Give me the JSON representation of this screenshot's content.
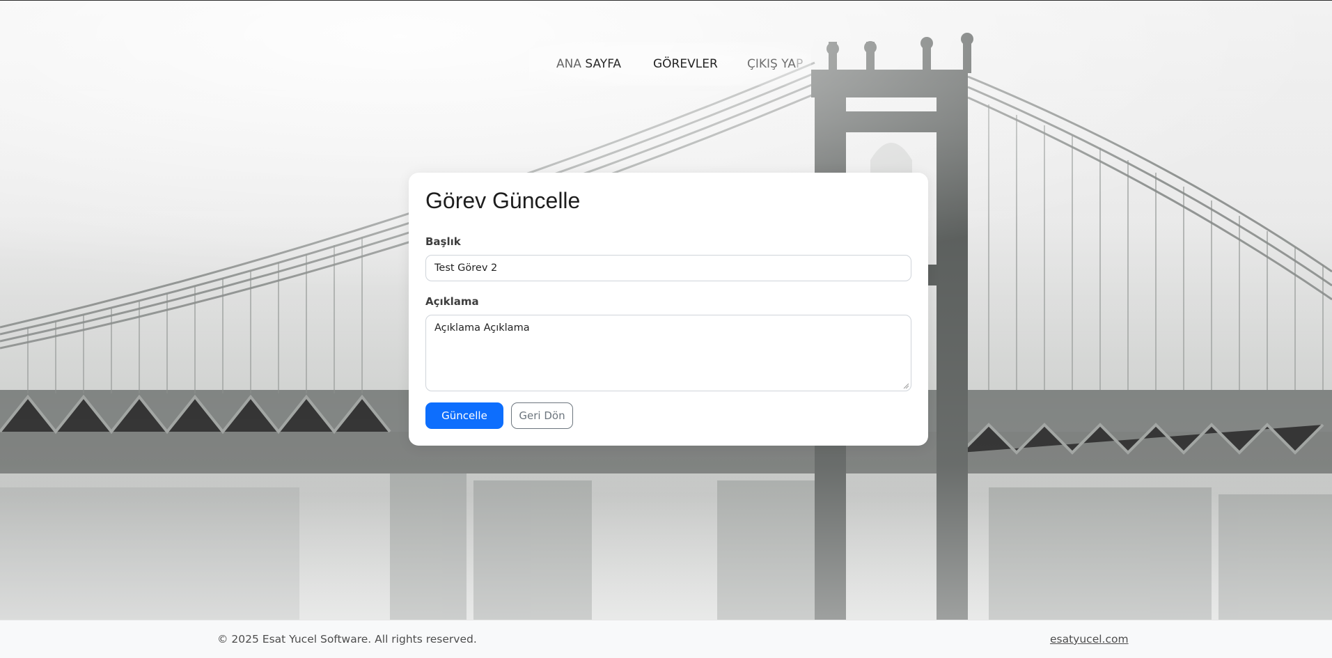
{
  "nav": {
    "home_prefix": "ANA",
    "home_suffix": " SAYFA",
    "tasks": "GÖREVLER",
    "logout_main": "ÇIKIŞ YA",
    "logout_fade": "P"
  },
  "form": {
    "title": "Görev Güncelle",
    "title_label": "Başlık",
    "title_value": "Test Görev 2",
    "description_label": "Açıklama",
    "description_value": "Açıklama Açıklama",
    "submit_label": "Güncelle",
    "back_label": "Geri Dön"
  },
  "footer": {
    "copyright": "© 2025 Esat Yucel Software. All rights reserved.",
    "link": "esatyucel.com"
  },
  "colors": {
    "primary": "#0d6efd",
    "secondary": "#6c757d",
    "footer_bg": "#f8f9fa"
  },
  "background_scene": "foggy-suspension-bridge"
}
